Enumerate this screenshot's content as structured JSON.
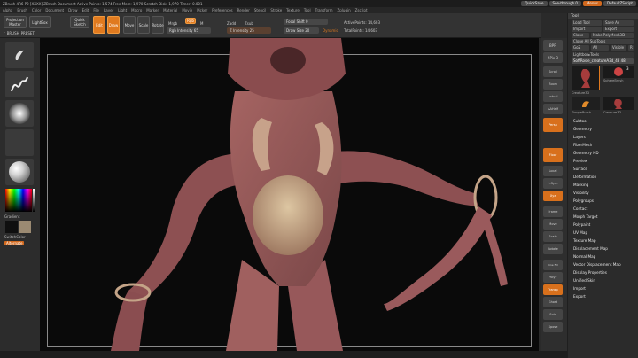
{
  "window": {
    "title": "ZBrush 4R6 P2 [XXXX] ZBrush Document   Active Points: 1,574   Free Mem: 1,970  Scratch Disk: 1,970  Timer: 0.001",
    "quicksave": "QuickSave",
    "see_through": "See-through 0",
    "menus": "Menus",
    "default_script": "DefaultZScript"
  },
  "menubar": [
    "Alpha",
    "Brush",
    "Color",
    "Document",
    "Draw",
    "Edit",
    "File",
    "Layer",
    "Light",
    "Macro",
    "Marker",
    "Material",
    "Movie",
    "Picker",
    "Preferences",
    "Render",
    "Stencil",
    "Stroke",
    "Texture",
    "Tool",
    "Transform",
    "Zplugin",
    "Zscript"
  ],
  "toolbar": {
    "projection_master": "Projection Master",
    "lightbox": "LightBox",
    "quick_sketch": "Quick Sketch",
    "edit": "Edit",
    "draw": "Draw",
    "move": "Move",
    "scale": "Scale",
    "rotate": "Rotate",
    "mrgb": "Mrgb",
    "rgb": "Rgb",
    "m": "M",
    "rgb_intensity": "Rgb Intensity 65",
    "zadd": "Zadd",
    "zsub": "Zsub",
    "z_intensity": "Z Intensity 25",
    "focal_shift": "Focal Shift 0",
    "draw_size": "Draw Size 20",
    "dynamic": "Dynamic",
    "active_points": "ActivePoints: 14,603",
    "total_points": "TotalPoints: 14,603",
    "doc_label": "r_BRUSH_PRESET"
  },
  "left_tray": {
    "gradient": "Gradient",
    "switch_color": "SwitchColor",
    "alternate": "Alternate"
  },
  "toolpanel": {
    "title": "Tool",
    "load_tool": "Load Tool",
    "save_as": "Save As",
    "import": "Import",
    "export": "Export",
    "clone": "Clone",
    "make_polymesh": "Make PolyMesh3D",
    "clone_all": "Clone All SubTools",
    "goz": "GoZ",
    "all": "All",
    "visible": "Visible",
    "r": "R",
    "lightbox_tools": "Lightbox▸Tools",
    "current_tool": "SoftRosie_creatureA3d_48 48",
    "thumbs": [
      "Creature3D",
      "SphereBrush",
      "SimpleBrush",
      "Creature3D"
    ],
    "thumb_count": "3",
    "menu": [
      "Subtool",
      "Geometry",
      "Layers",
      "FiberMesh",
      "Geometry HD",
      "Preview",
      "Surface",
      "Deformation",
      "Masking",
      "Visibility",
      "Polygroups",
      "Contact",
      "Morph Target",
      "Polypaint",
      "UV Map",
      "Texture Map",
      "Displacement Map",
      "Normal Map",
      "Vector Displacement Map",
      "Display Properties",
      "Unified Skin",
      "Import",
      "Export"
    ]
  },
  "right_shelf": {
    "bpr": "BPR",
    "spix": "SPix 3",
    "scroll": "Scroll",
    "zoom": "Zoom",
    "actual": "Actual",
    "aahalf": "AAHalf",
    "persp": "Persp",
    "floor": "Floor",
    "local": "Local",
    "lsym": "L.Sym",
    "xyz": "Xyz",
    "frame": "Frame",
    "move": "Move",
    "scale": "Scale",
    "rotate": "Rotate",
    "line_fill": "Line Fill",
    "polyf": "PolyF",
    "transp": "Transp",
    "ghost": "Ghost",
    "solo": "Solo",
    "xpose": "Xpose"
  },
  "colors": {
    "accent": "#e07a1f",
    "creature_skin": "#b06a68",
    "background": "#0a0a0a"
  }
}
